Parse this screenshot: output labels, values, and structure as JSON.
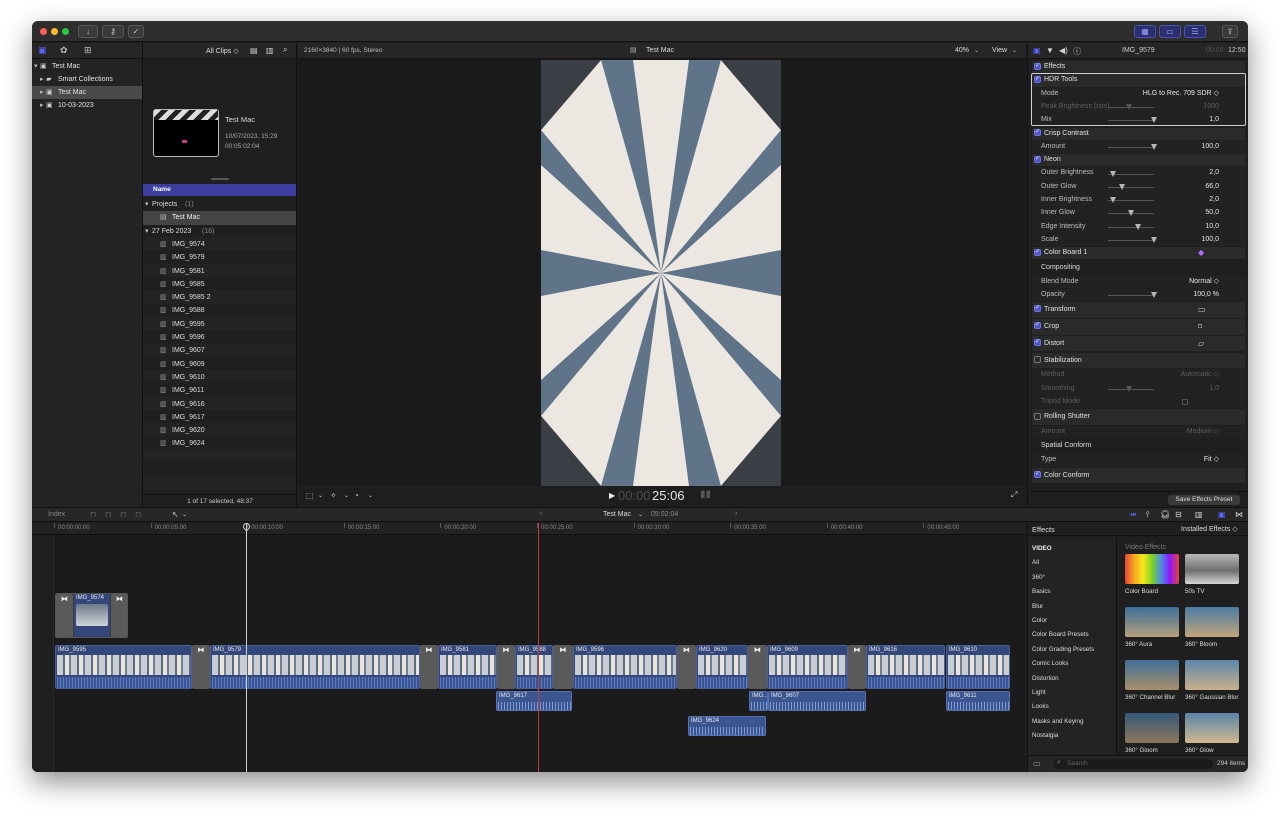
{
  "window": {
    "colors": {
      "accent": "#4e55c9",
      "playhead": "#c23b3b",
      "clip_blue": "#34477a",
      "audio_blue": "#3b5591"
    }
  },
  "library": {
    "clip_filter": "All Clips ◇",
    "items": [
      {
        "label": "Test Mac",
        "level": 0,
        "arrow": "▾",
        "icon": "library-icon"
      },
      {
        "label": "Smart Collections",
        "level": 1,
        "arrow": "▸",
        "icon": "folder-icon"
      },
      {
        "label": "Test Mac",
        "level": 1,
        "arrow": "▸",
        "icon": "event-icon",
        "selected": true
      },
      {
        "label": "10-03-2023",
        "level": 1,
        "arrow": "▸",
        "icon": "event-icon"
      }
    ]
  },
  "browser": {
    "project_title": "Test Mac",
    "project_date": "10/07/2023, 15:29",
    "project_duration": "00:05:02:04",
    "col_name": "Name",
    "group_projects": "Projects",
    "group_projects_count": "(1)",
    "project_item": "Test Mac",
    "group_date": "27 Feb 2023",
    "group_date_count": "(16)",
    "clips": [
      "IMG_9574",
      "IMG_9579",
      "IMG_9581",
      "IMG_9585",
      "IMG_9585 2",
      "IMG_9588",
      "IMG_9595",
      "IMG_9596",
      "IMG_9607",
      "IMG_9609",
      "IMG_9610",
      "IMG_9611",
      "IMG_9616",
      "IMG_9617",
      "IMG_9620",
      "IMG_9624"
    ],
    "status": "1 of 17 selected, 48:37"
  },
  "viewer": {
    "format": "2160×3840 | 60 fps, Stereo",
    "title": "Test Mac",
    "zoom": "40%",
    "view": "View",
    "timecode_dim": "00:00",
    "timecode": "25:06"
  },
  "inspector": {
    "clip_name": "IMG_9579",
    "timecode_dim": "00:00:",
    "timecode": "12:50",
    "rows": [
      {
        "kind": "section",
        "label": "Effects",
        "checked": true
      },
      {
        "kind": "section",
        "label": "HDR Tools",
        "checked": true,
        "highlight": true
      },
      {
        "kind": "param",
        "label": "Mode",
        "value": "HLG to Rec. 709 SDR ◇",
        "highlight": true
      },
      {
        "kind": "param",
        "label": "Peak Brightness (nits)",
        "value": "1000",
        "disabled": true,
        "highlight": true,
        "slider": 0.45
      },
      {
        "kind": "param",
        "label": "Mix",
        "value": "1,0",
        "highlight": true,
        "slider": 1.0
      },
      {
        "kind": "section",
        "label": "Crisp Contrast",
        "checked": true
      },
      {
        "kind": "param",
        "label": "Amount",
        "value": "100,0",
        "slider": 1.0
      },
      {
        "kind": "section",
        "label": "Neon",
        "checked": true
      },
      {
        "kind": "param",
        "label": "Outer Brightness",
        "value": "2,0",
        "slider": 0.1
      },
      {
        "kind": "param",
        "label": "Outer Glow",
        "value": "66,0",
        "slider": 0.3
      },
      {
        "kind": "param",
        "label": "Inner Brightness",
        "value": "2,0",
        "slider": 0.1
      },
      {
        "kind": "param",
        "label": "Inner Glow",
        "value": "50,0",
        "slider": 0.5
      },
      {
        "kind": "param",
        "label": "Edge Intensity",
        "value": "10,0",
        "slider": 0.65
      },
      {
        "kind": "param",
        "label": "Scale",
        "value": "100,0",
        "slider": 1.0
      },
      {
        "kind": "section",
        "label": "Color Board 1",
        "checked": true,
        "icon": "color-board-icon"
      },
      {
        "kind": "group",
        "label": "Compositing"
      },
      {
        "kind": "param",
        "label": "Blend Mode",
        "value": "Normal ◇"
      },
      {
        "kind": "param",
        "label": "Opacity",
        "value": "100,0 %",
        "slider": 1.0
      },
      {
        "kind": "section",
        "label": "Transform",
        "checked": true,
        "icon": "transform-icon"
      },
      {
        "kind": "section",
        "label": "Crop",
        "checked": true,
        "icon": "crop-icon"
      },
      {
        "kind": "section",
        "label": "Distort",
        "checked": true,
        "icon": "distort-icon"
      },
      {
        "kind": "section",
        "label": "Stabilization",
        "checked": false
      },
      {
        "kind": "param",
        "label": "Method",
        "value": "Automatic ◇",
        "disabled": true
      },
      {
        "kind": "param",
        "label": "Smoothing",
        "value": "1,0",
        "disabled": true,
        "slider": 0.45
      },
      {
        "kind": "param",
        "label": "Tripod Mode",
        "value": "",
        "disabled": true
      },
      {
        "kind": "section",
        "label": "Rolling Shutter",
        "checked": false
      },
      {
        "kind": "param",
        "label": "Amount",
        "value": "Medium ◇",
        "disabled": true
      },
      {
        "kind": "group",
        "label": "Spatial Conform"
      },
      {
        "kind": "param",
        "label": "Type",
        "value": "Fit ◇"
      },
      {
        "kind": "section",
        "label": "Color Conform",
        "checked": true
      }
    ],
    "save_preset": "Save Effects Preset"
  },
  "timeline": {
    "index": "Index",
    "project": "Test Mac",
    "duration": "05:02:04",
    "ruler": [
      "00:00:00:00",
      "00:00:05:00",
      "00:00:10:00",
      "00:00:15:00",
      "00:00:20:00",
      "00:00:25:00",
      "00:00:30:00",
      "00:00:35:00",
      "00:00:40:00",
      "00:00:45:00"
    ],
    "upper_clip": "IMG_9574",
    "primary_clips": [
      {
        "name": "IMG_9595",
        "start": 0,
        "end": 137
      },
      {
        "name": "IMG_9579",
        "start": 155,
        "end": 365
      },
      {
        "name": "IMG_9581",
        "start": 383,
        "end": 442
      },
      {
        "name": "IMG_9588",
        "start": 460,
        "end": 498
      },
      {
        "name": "IMG_9596",
        "start": 518,
        "end": 622
      },
      {
        "name": "IMG_9620",
        "start": 641,
        "end": 693
      },
      {
        "name": "IMG_9609",
        "start": 712,
        "end": 793
      },
      {
        "name": "IMG_9616",
        "start": 811,
        "end": 890
      },
      {
        "name": "IMG_9610",
        "start": 891,
        "end": 955
      }
    ],
    "connected_clips": [
      {
        "name": "IMG_9617",
        "start": 441,
        "end": 517,
        "lane": 1
      },
      {
        "name": "IMG...",
        "start": 694,
        "end": 713,
        "lane": 1
      },
      {
        "name": "IMG_9607",
        "start": 713,
        "end": 811,
        "lane": 1
      },
      {
        "name": "IMG_9611",
        "start": 891,
        "end": 955,
        "lane": 1
      },
      {
        "name": "IMG_9624",
        "start": 633,
        "end": 711,
        "lane": 2
      }
    ]
  },
  "effects_browser": {
    "title": "Effects",
    "filter": "Installed Effects ◇",
    "section_title": "Video Effects",
    "categories": [
      "VIDEO",
      "All",
      "360°",
      "Basics",
      "Blur",
      "Color",
      "Color Board Presets",
      "Color Grading Presets",
      "Comic Looks",
      "Distortion",
      "Light",
      "Looks",
      "Masks and Keying",
      "Nostalgia"
    ],
    "items": [
      "Color Board",
      "50s TV",
      "360° Aura",
      "360° Bloom",
      "360° Channel Blur",
      "360° Gaussian Blur",
      "360° Gloom",
      "360° Glow"
    ],
    "search_placeholder": "Search",
    "count": "294 items"
  }
}
